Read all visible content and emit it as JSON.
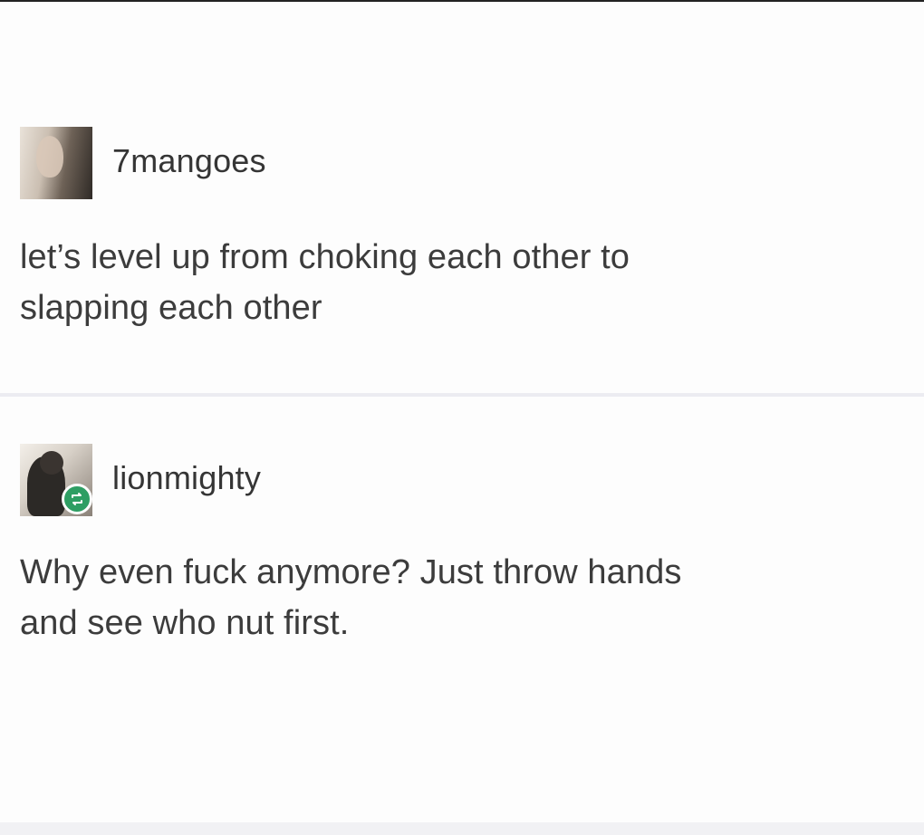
{
  "posts": [
    {
      "username": "7mangoes",
      "avatar_icon": "user-photo-avatar",
      "text": "let’s level up from choking each other to\nslapping each other"
    },
    {
      "username": "lionmighty",
      "avatar_icon": "user-photo-avatar",
      "badge_icon": "reblog-icon",
      "text": "Why even fuck anymore? Just throw hands\nand see who nut first."
    }
  ],
  "colors": {
    "text": "#3c3c3c",
    "username": "#353535",
    "reblog_badge": "#2e9e63",
    "divider": "#ececf1",
    "background": "#fdfdfd"
  }
}
